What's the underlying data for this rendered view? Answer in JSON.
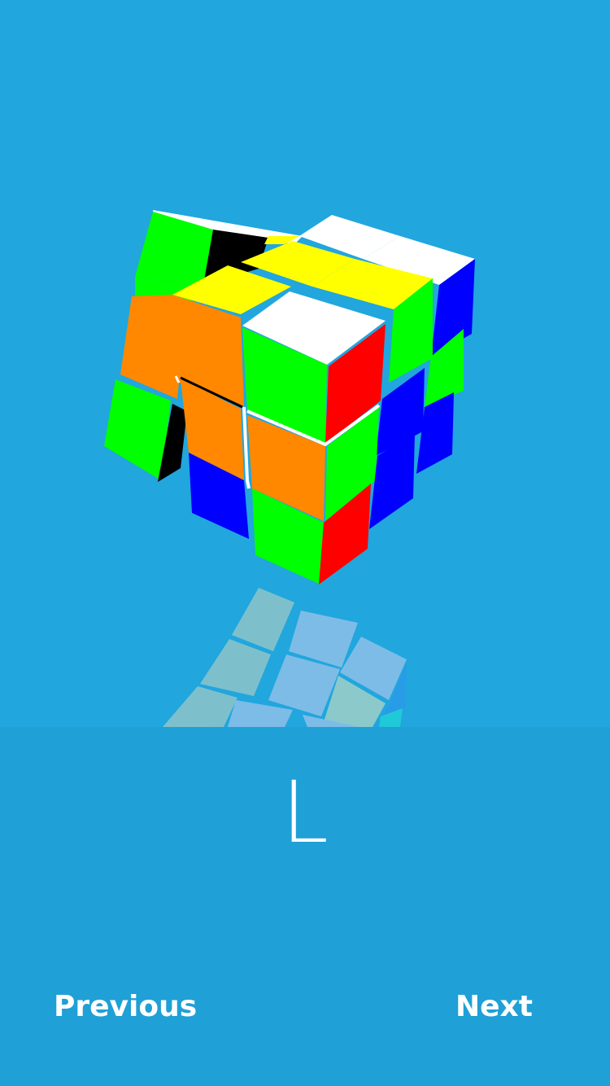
{
  "current_move": "L",
  "navigation": {
    "previous_label": "Previous",
    "next_label": "Next"
  },
  "colors": {
    "background": "#21a6de",
    "panel": "#1fa0d6",
    "text": "#ffffff",
    "cube_green": "#00ff00",
    "cube_orange": "#ff8800",
    "cube_yellow": "#ffff00",
    "cube_white": "#ffffff",
    "cube_red": "#ff0000",
    "cube_blue": "#0000ff",
    "cube_black": "#000000"
  },
  "icons": {
    "cube_viewer": "rubiks-cube-3d-icon"
  }
}
